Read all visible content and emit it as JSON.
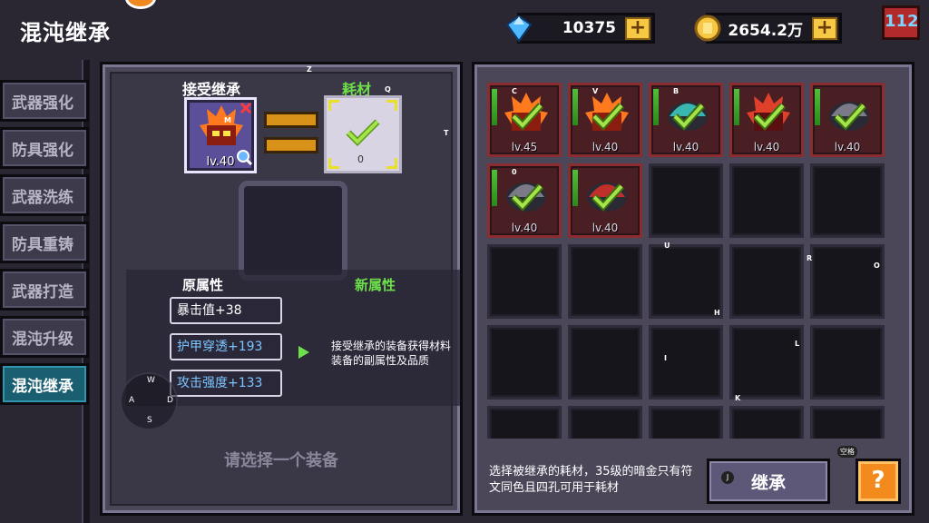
{
  "header": {
    "title": "混沌继承",
    "gems": "10375",
    "gold": "2654.2万",
    "plus": "+",
    "level": "112"
  },
  "sidebar": {
    "items": [
      {
        "label": "武器强化",
        "active": false
      },
      {
        "label": "防具强化",
        "active": false
      },
      {
        "label": "武器洗练",
        "active": false
      },
      {
        "label": "防具重铸",
        "active": false
      },
      {
        "label": "武器打造",
        "active": false
      },
      {
        "label": "混沌升级",
        "active": false
      },
      {
        "label": "混沌继承",
        "active": true
      }
    ]
  },
  "forge": {
    "accept_label": "接受继承",
    "material_label": "耗材",
    "accept_item_level": "lv.40",
    "material_item_level": "0",
    "original_attrs_title": "原属性",
    "new_attrs_title": "新属性",
    "attrs": [
      "暴击值+38",
      "护甲穿透+193",
      "攻击强度+133"
    ],
    "hint": "接受继承的装备获得材料装备的副属性及品质",
    "select_prompt": "请选择一个装备"
  },
  "inventory": {
    "items": [
      {
        "lv": "lv.45",
        "type": "mask-fire",
        "key": "C"
      },
      {
        "lv": "lv.40",
        "type": "mask-fire",
        "key": "V"
      },
      {
        "lv": "lv.40",
        "type": "helm-teal",
        "key": "B"
      },
      {
        "lv": "lv.40",
        "type": "mask-red",
        "key": ""
      },
      {
        "lv": "lv.40",
        "type": "helm-grey",
        "key": ""
      },
      {
        "lv": "lv.40",
        "type": "helm-grey",
        "key": "0"
      },
      {
        "lv": "lv.40",
        "type": "helm-red",
        "key": ""
      }
    ],
    "bottom_hint": "选择被继承的耗材，35级的暗金只有符文同色且四孔可用于耗材",
    "inherit_button": "继承",
    "help_button": "?",
    "space_tag": "空格",
    "j_tag": "J"
  },
  "keys": {
    "z": "Z",
    "q": "Q",
    "t": "T",
    "u": "U",
    "r": "R",
    "o": "O",
    "h": "H",
    "i": "I",
    "l": "L",
    "k": "K",
    "m": "M",
    "w": "W",
    "a": "A",
    "d": "D",
    "s": "S"
  },
  "colors": {
    "item_cell_bg": "#4a1f24",
    "empty_cell_bg": "#16151b",
    "active_tab": "#1a5f71",
    "attr_blue": "#7cc6ff",
    "gold": "#f6c843"
  }
}
